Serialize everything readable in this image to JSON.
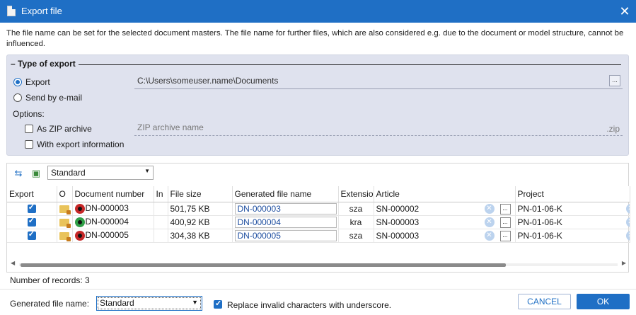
{
  "window": {
    "title": "Export file",
    "close_icon": "close-icon"
  },
  "intro_text": "The file name can be set for the selected document masters. The file name for further files, which are also considered e.g. due to the document or model structure, cannot be influenced.",
  "type_of_export": {
    "legend": "Type of export",
    "export_label": "Export",
    "export_selected": true,
    "email_label": "Send by e-mail",
    "email_selected": false,
    "export_path": "C:\\Users\\someuser.name\\Documents",
    "browse_label": "...",
    "options_label": "Options:",
    "zip_label": "As ZIP archive",
    "zip_checked": false,
    "zip_placeholder": "ZIP archive name",
    "zip_ext": ".zip",
    "export_info_label": "With export information",
    "export_info_checked": false
  },
  "toolbar": {
    "refresh_icon": "refresh-icon",
    "image_icon": "image-icon",
    "view_select": "Standard"
  },
  "table": {
    "columns": [
      "Export",
      "O",
      "Document number",
      "In",
      "File size",
      "Generated file name",
      "Extensio",
      "Article",
      "Project"
    ],
    "rows": [
      {
        "export": true,
        "document_number": "DN-000003",
        "status": "red",
        "file_size": "501,75 KB",
        "generated_name": "DN-000003",
        "extension": "sza",
        "article": "SN-000002",
        "project": "PN-01-06-K"
      },
      {
        "export": true,
        "document_number": "DN-000004",
        "status": "green",
        "file_size": "400,92 KB",
        "generated_name": "DN-000004",
        "extension": "kra",
        "article": "SN-000003",
        "project": "PN-01-06-K"
      },
      {
        "export": true,
        "document_number": "DN-000005",
        "status": "red",
        "file_size": "304,38 KB",
        "generated_name": "DN-000005",
        "extension": "sza",
        "article": "SN-000003",
        "project": "PN-01-06-K"
      }
    ]
  },
  "records_label": "Number of records: 3",
  "footer": {
    "generated_file_name_label": "Generated file name:",
    "generated_file_name_value": "Standard",
    "replace_label": "Replace invalid characters with underscore.",
    "replace_checked": true,
    "cancel_label": "CANCEL",
    "ok_label": "OK"
  },
  "colors": {
    "accent": "#1f6fc5",
    "panel": "#dfe2ee"
  }
}
